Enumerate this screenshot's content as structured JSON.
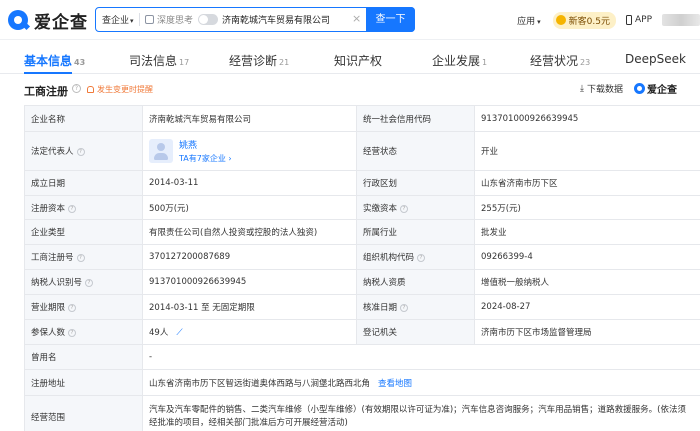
{
  "brand": {
    "name": "爱企查",
    "color": "#1677ff"
  },
  "search": {
    "scope_label": "查企业",
    "deep_think_label": "深度思考",
    "query": "济南乾城汽车贸易有限公司",
    "button_label": "查一下"
  },
  "topnav": {
    "apply_label": "应用",
    "newcust_label": "新客0.5元",
    "app_label": "APP"
  },
  "tabs": [
    {
      "label": "基本信息",
      "count": "43"
    },
    {
      "label": "司法信息",
      "count": "17"
    },
    {
      "label": "经营诊断",
      "count": "21"
    },
    {
      "label": "知识产权",
      "count": ""
    },
    {
      "label": "企业发展",
      "count": "1"
    },
    {
      "label": "经营状况",
      "count": "23"
    },
    {
      "label": "DeepSeek",
      "count": ""
    }
  ],
  "section": {
    "title": "工商注册",
    "alert": "发生变更时提醒",
    "download_label": "下载数据",
    "brand_small": "爱企查"
  },
  "info": {
    "company_name_label": "企业名称",
    "company_name": "济南乾城汽车贸易有限公司",
    "credit_code_label": "统一社会信用代码",
    "credit_code": "913701000926639945",
    "legal_rep_label": "法定代表人",
    "legal_rep_name": "姚燕",
    "legal_rep_sub": "TA有7家企业",
    "status_label": "经营状态",
    "status": "开业",
    "founded_label": "成立日期",
    "founded": "2014-03-11",
    "region_label": "行政区划",
    "region": "山东省济南市历下区",
    "reg_capital_label": "注册资本",
    "reg_capital": "500万(元)",
    "paid_capital_label": "实缴资本",
    "paid_capital": "255万(元)",
    "type_label": "企业类型",
    "type": "有限责任公司(自然人投资或控股的法人独资)",
    "industry_label": "所属行业",
    "industry": "批发业",
    "reg_no_label": "工商注册号",
    "reg_no": "370127200087689",
    "org_code_label": "组织机构代码",
    "org_code": "09266399-4",
    "tax_id_label": "纳税人识别号",
    "tax_id": "913701000926639945",
    "taxpayer_label": "纳税人资质",
    "taxpayer": "增值税一般纳税人",
    "term_label": "营业期限",
    "term": "2014-03-11 至 无固定期限",
    "approval_label": "核准日期",
    "approval": "2024-08-27",
    "insured_label": "参保人数",
    "insured": "49人",
    "authority_label": "登记机关",
    "authority": "济南市历下区市场监督管理局",
    "former_name_label": "曾用名",
    "former_name": "-",
    "address_label": "注册地址",
    "address": "山东省济南市历下区智远街道奥体西路与八涧堡北路西北角",
    "map_link": "查看地图",
    "scope_label": "经营范围",
    "scope": "汽车及汽车零配件的销售、二类汽车维修（小型车维修）(有效期限以许可证为准)；汽车信息咨询服务；汽车用品销售；道路救援服务。(依法须经批准的项目，经相关部门批准后方可开展经营活动)"
  }
}
